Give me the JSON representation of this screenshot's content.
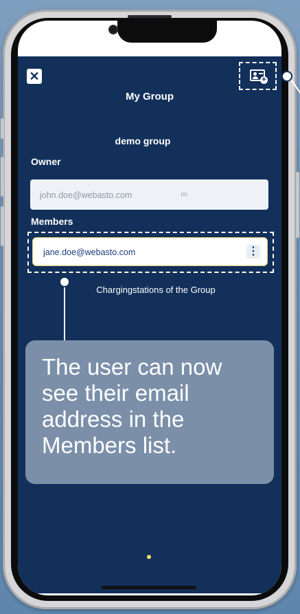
{
  "header": {
    "title": "My Group",
    "close_icon": "close-icon",
    "add_member_icon": "add-member-icon"
  },
  "group": {
    "name": "demo group"
  },
  "owner": {
    "label": "Owner",
    "email": "john.doe@webasto.com",
    "extra_mark": "ՠ"
  },
  "members": {
    "label": "Members",
    "items": [
      {
        "email": "jane.doe@webasto.com",
        "menu_icon": "more-vertical-icon"
      }
    ]
  },
  "stations": {
    "title": "Chargingstations of the Group"
  },
  "annotation": {
    "text": "The user can now see their email address in the Members list."
  },
  "colors": {
    "app_background": "#12305a",
    "accent_yellow": "#f2e277",
    "annotation_box": "#7b8fa9"
  }
}
